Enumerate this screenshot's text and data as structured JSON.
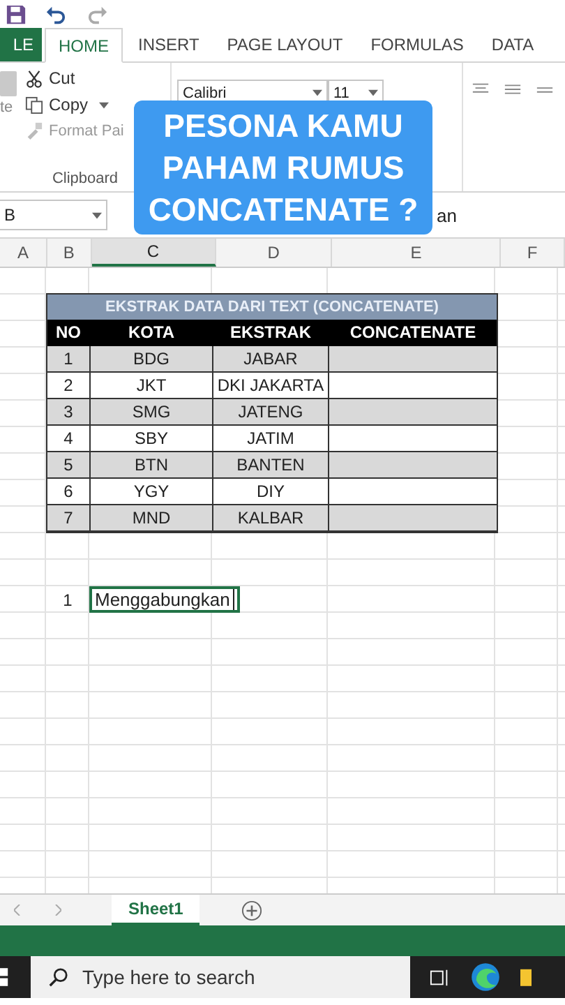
{
  "ribbon_tabs": [
    {
      "label": "LE",
      "kind": "file",
      "selected": false
    },
    {
      "label": "HOME",
      "kind": "tab",
      "selected": true
    },
    {
      "label": "INSERT",
      "kind": "tab",
      "selected": false
    },
    {
      "label": "PAGE LAYOUT",
      "kind": "tab",
      "selected": false
    },
    {
      "label": "FORMULAS",
      "kind": "tab",
      "selected": false
    },
    {
      "label": "DATA",
      "kind": "tab",
      "selected": false
    }
  ],
  "clipboard": {
    "paste": "te",
    "cut": "Cut",
    "copy": "Copy",
    "format_painter": "Format Pai",
    "group": "Clipboard"
  },
  "font": {
    "name": "Calibri",
    "size": "11"
  },
  "name_box": "B",
  "formula_text": "an",
  "column_headers": [
    {
      "label": "A",
      "selected": false
    },
    {
      "label": "B",
      "selected": false
    },
    {
      "label": "C",
      "selected": true
    },
    {
      "label": "D",
      "selected": false
    },
    {
      "label": "E",
      "selected": false
    },
    {
      "label": "F",
      "selected": false
    }
  ],
  "table": {
    "title": "EKSTRAK DATA DARI TEXT (CONCATENATE)",
    "columns": [
      "NO",
      "KOTA",
      "EKSTRAK",
      "CONCATENATE"
    ],
    "rows": [
      {
        "no": "1",
        "kota": "BDG",
        "ekstrak": "JABAR"
      },
      {
        "no": "2",
        "kota": "JKT",
        "ekstrak": "DKI JAKARTA"
      },
      {
        "no": "3",
        "kota": "SMG",
        "ekstrak": "JATENG"
      },
      {
        "no": "4",
        "kota": "SBY",
        "ekstrak": "JATIM"
      },
      {
        "no": "5",
        "kota": "BTN",
        "ekstrak": "BANTEN"
      },
      {
        "no": "6",
        "kota": "YGY",
        "ekstrak": "DIY"
      },
      {
        "no": "7",
        "kota": "MND",
        "ekstrak": "KALBAR"
      }
    ]
  },
  "entry": {
    "number": "1",
    "text": "Menggabungkan"
  },
  "sheet_tabs": [
    {
      "label": "Sheet1",
      "selected": true
    }
  ],
  "taskbar": {
    "search_placeholder": "Type here to search"
  },
  "overlay_title": "PESONA KAMU\nPAHAM RUMUS\nCONCATENATE ?"
}
